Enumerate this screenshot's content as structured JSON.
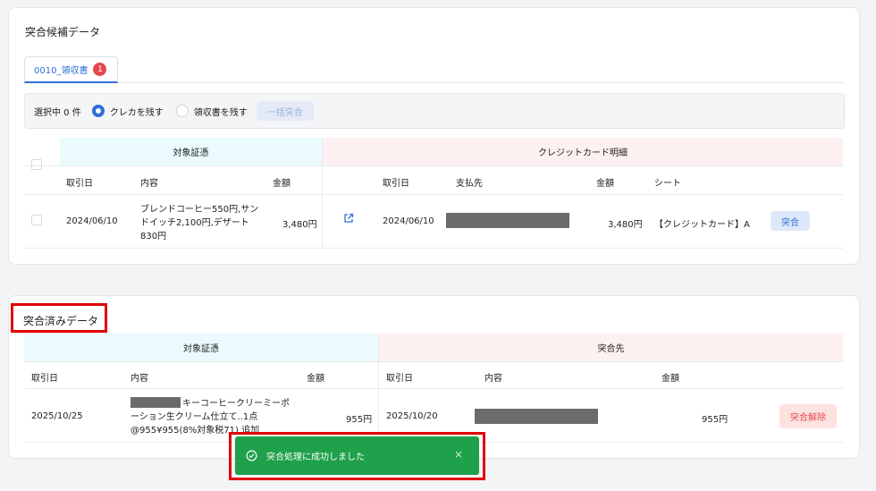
{
  "candidates": {
    "title": "突合候補データ",
    "tab": {
      "label": "0010_領収書",
      "badge": "1"
    },
    "toolbar": {
      "selected": "選択中 0 件",
      "option_keep_card": "クレカを残す",
      "option_keep_receipt": "領収書を残す",
      "bulk_button": "一括突合"
    },
    "group_evidence": "対象証憑",
    "group_card": "クレジットカード明細",
    "columns": {
      "date": "取引日",
      "content": "内容",
      "amount": "金額",
      "card_date": "取引日",
      "payee": "支払先",
      "card_amount": "金額",
      "sheet": "シート"
    },
    "rows": [
      {
        "date": "2024/06/10",
        "content": "ブレンドコーヒー550円,サンドイッチ2,100円,デザート830円",
        "amount": "3,480円",
        "card_date": "2024/06/10",
        "card_amount": "3,480円",
        "sheet": "【クレジットカード】A",
        "action": "突合"
      }
    ]
  },
  "matched": {
    "title": "突合済みデータ",
    "group_evidence": "対象証憑",
    "group_target": "突合先",
    "columns": {
      "date": "取引日",
      "content": "内容",
      "amount": "金額",
      "target_date": "取引日",
      "target_content": "内容",
      "target_amount": "金額"
    },
    "rows": [
      {
        "date": "2025/10/25",
        "content": "キーコーヒークリーミーポーション生クリーム仕立て..1点@955¥955(8%対象税71) 追加",
        "amount": "955円",
        "target_date": "2025/10/20",
        "target_amount": "955円",
        "action": "突合解除"
      }
    ]
  },
  "toast": {
    "message": "突合処理に成功しました",
    "close": "×"
  },
  "colors": {
    "accent": "#2f6fd6",
    "success": "#1fa04a",
    "danger": "#e5484d",
    "highlight": "#e00000"
  }
}
